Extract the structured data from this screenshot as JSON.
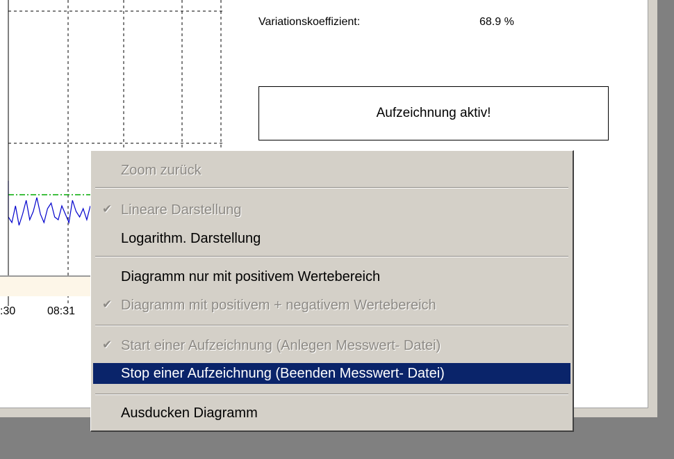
{
  "stats": {
    "label": "Variationskoeffizient:",
    "value": "68.9 %"
  },
  "record_status": "Aufzeichnung aktiv!",
  "chart_data": {
    "type": "line",
    "x_tick_labels": [
      ":30",
      "08:31"
    ],
    "series": [
      {
        "color": "#0000cc",
        "values": [
          5.2,
          5.0,
          5.6,
          4.9,
          5.3,
          5.8,
          5.1,
          5.4,
          5.9,
          5.3,
          5.0,
          5.5,
          5.7,
          5.2,
          5.1,
          5.6,
          5.3,
          5.0,
          5.8,
          5.4,
          5.2,
          5.5,
          5.1,
          5.6
        ]
      },
      {
        "color": "#00aa00",
        "style": "dash-dot",
        "values": [
          6.0,
          6.0
        ]
      }
    ],
    "grid": "dashed"
  },
  "menu": {
    "items": [
      {
        "label": "Zoom zurück",
        "disabled": true,
        "checked": false,
        "selected": false
      },
      {
        "label": "Lineare Darstellung",
        "disabled": true,
        "checked": true,
        "selected": false
      },
      {
        "label": "Logarithm. Darstellung",
        "disabled": false,
        "checked": false,
        "selected": false
      },
      {
        "label": "Diagramm nur mit positivem Wertebereich",
        "disabled": false,
        "checked": false,
        "selected": false
      },
      {
        "label": "Diagramm mit positivem + negativem Wertebereich",
        "disabled": true,
        "checked": true,
        "selected": false
      },
      {
        "label": "Start einer Aufzeichnung (Anlegen Messwert- Datei)",
        "disabled": true,
        "checked": true,
        "selected": false
      },
      {
        "label": "Stop einer Aufzeichnung (Beenden Messwert- Datei)",
        "disabled": false,
        "checked": false,
        "selected": true
      },
      {
        "label": "Ausducken Diagramm",
        "disabled": false,
        "checked": false,
        "selected": false
      }
    ],
    "check_glyph": "✔"
  }
}
